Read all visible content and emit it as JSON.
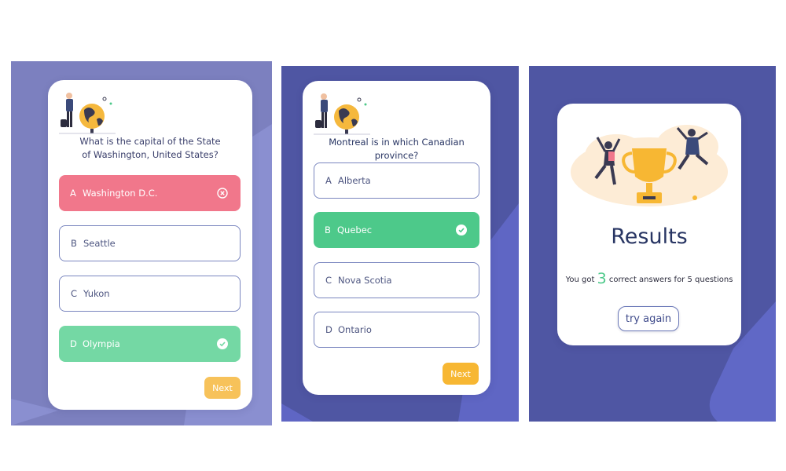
{
  "screens": [
    {
      "question": "What is the capital of the State of Washington, United States?",
      "options": [
        {
          "letter": "A",
          "text": "Washington D.C.",
          "state": "wrong"
        },
        {
          "letter": "B",
          "text": "Seattle",
          "state": "neutral"
        },
        {
          "letter": "C",
          "text": "Yukon",
          "state": "neutral"
        },
        {
          "letter": "D",
          "text": "Olympia",
          "state": "correct"
        }
      ],
      "next_label": "Next"
    },
    {
      "question": "Montreal is in which Canadian province?",
      "options": [
        {
          "letter": "A",
          "text": "Alberta",
          "state": "neutral"
        },
        {
          "letter": "B",
          "text": "Quebec",
          "state": "correct"
        },
        {
          "letter": "C",
          "text": "Nova Scotia",
          "state": "neutral"
        },
        {
          "letter": "D",
          "text": "Ontario",
          "state": "neutral"
        }
      ],
      "next_label": "Next"
    },
    {
      "title": "Results",
      "summary_prefix": "You got",
      "correct_count": "3",
      "summary_suffix": "correct answers for 5 questions",
      "try_again_label": "try again"
    }
  ],
  "colors": {
    "panel_bg_1": "#7c80bf",
    "panel_bg_2": "#4f56a3",
    "accent_shape": "#6068c6",
    "wrong": "#f1778b",
    "correct": "#4dc98a",
    "next": "#f7b733",
    "title": "#283563"
  },
  "icons": {
    "wrong": "x-circle-icon",
    "correct": "check-circle-icon"
  }
}
